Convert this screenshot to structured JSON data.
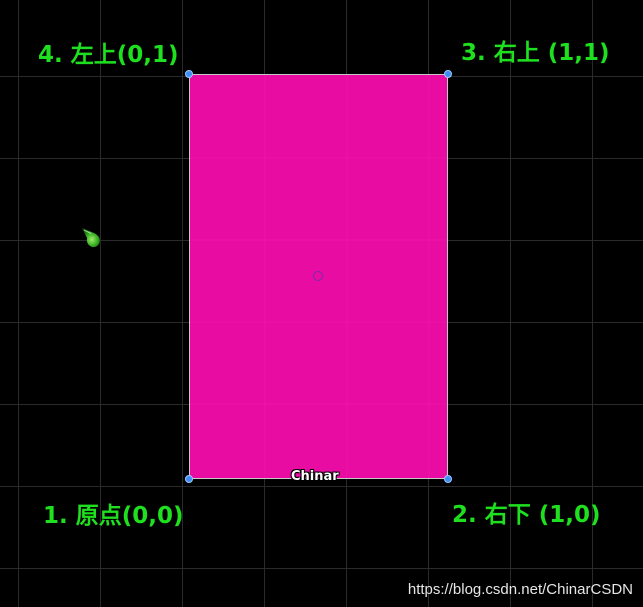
{
  "scene": {
    "background_color": "#000000",
    "grid_color": "#2a2a2a"
  },
  "corner_labels": {
    "top_left": "4. 左上(0,1)",
    "top_right": "3. 右上 (1,1)",
    "bottom_left": "1. 原点(0,0)",
    "bottom_right": "2. 右下 (1,0)"
  },
  "label_color": "#1ee01e",
  "quad": {
    "fill_color": "#e80ca2",
    "object_name": "Chinar"
  },
  "icons": {
    "light": "light-icon",
    "pivot": "pivot-icon",
    "handles": "vertex-handle"
  },
  "watermark": "https://blog.csdn.net/ChinarCSDN"
}
